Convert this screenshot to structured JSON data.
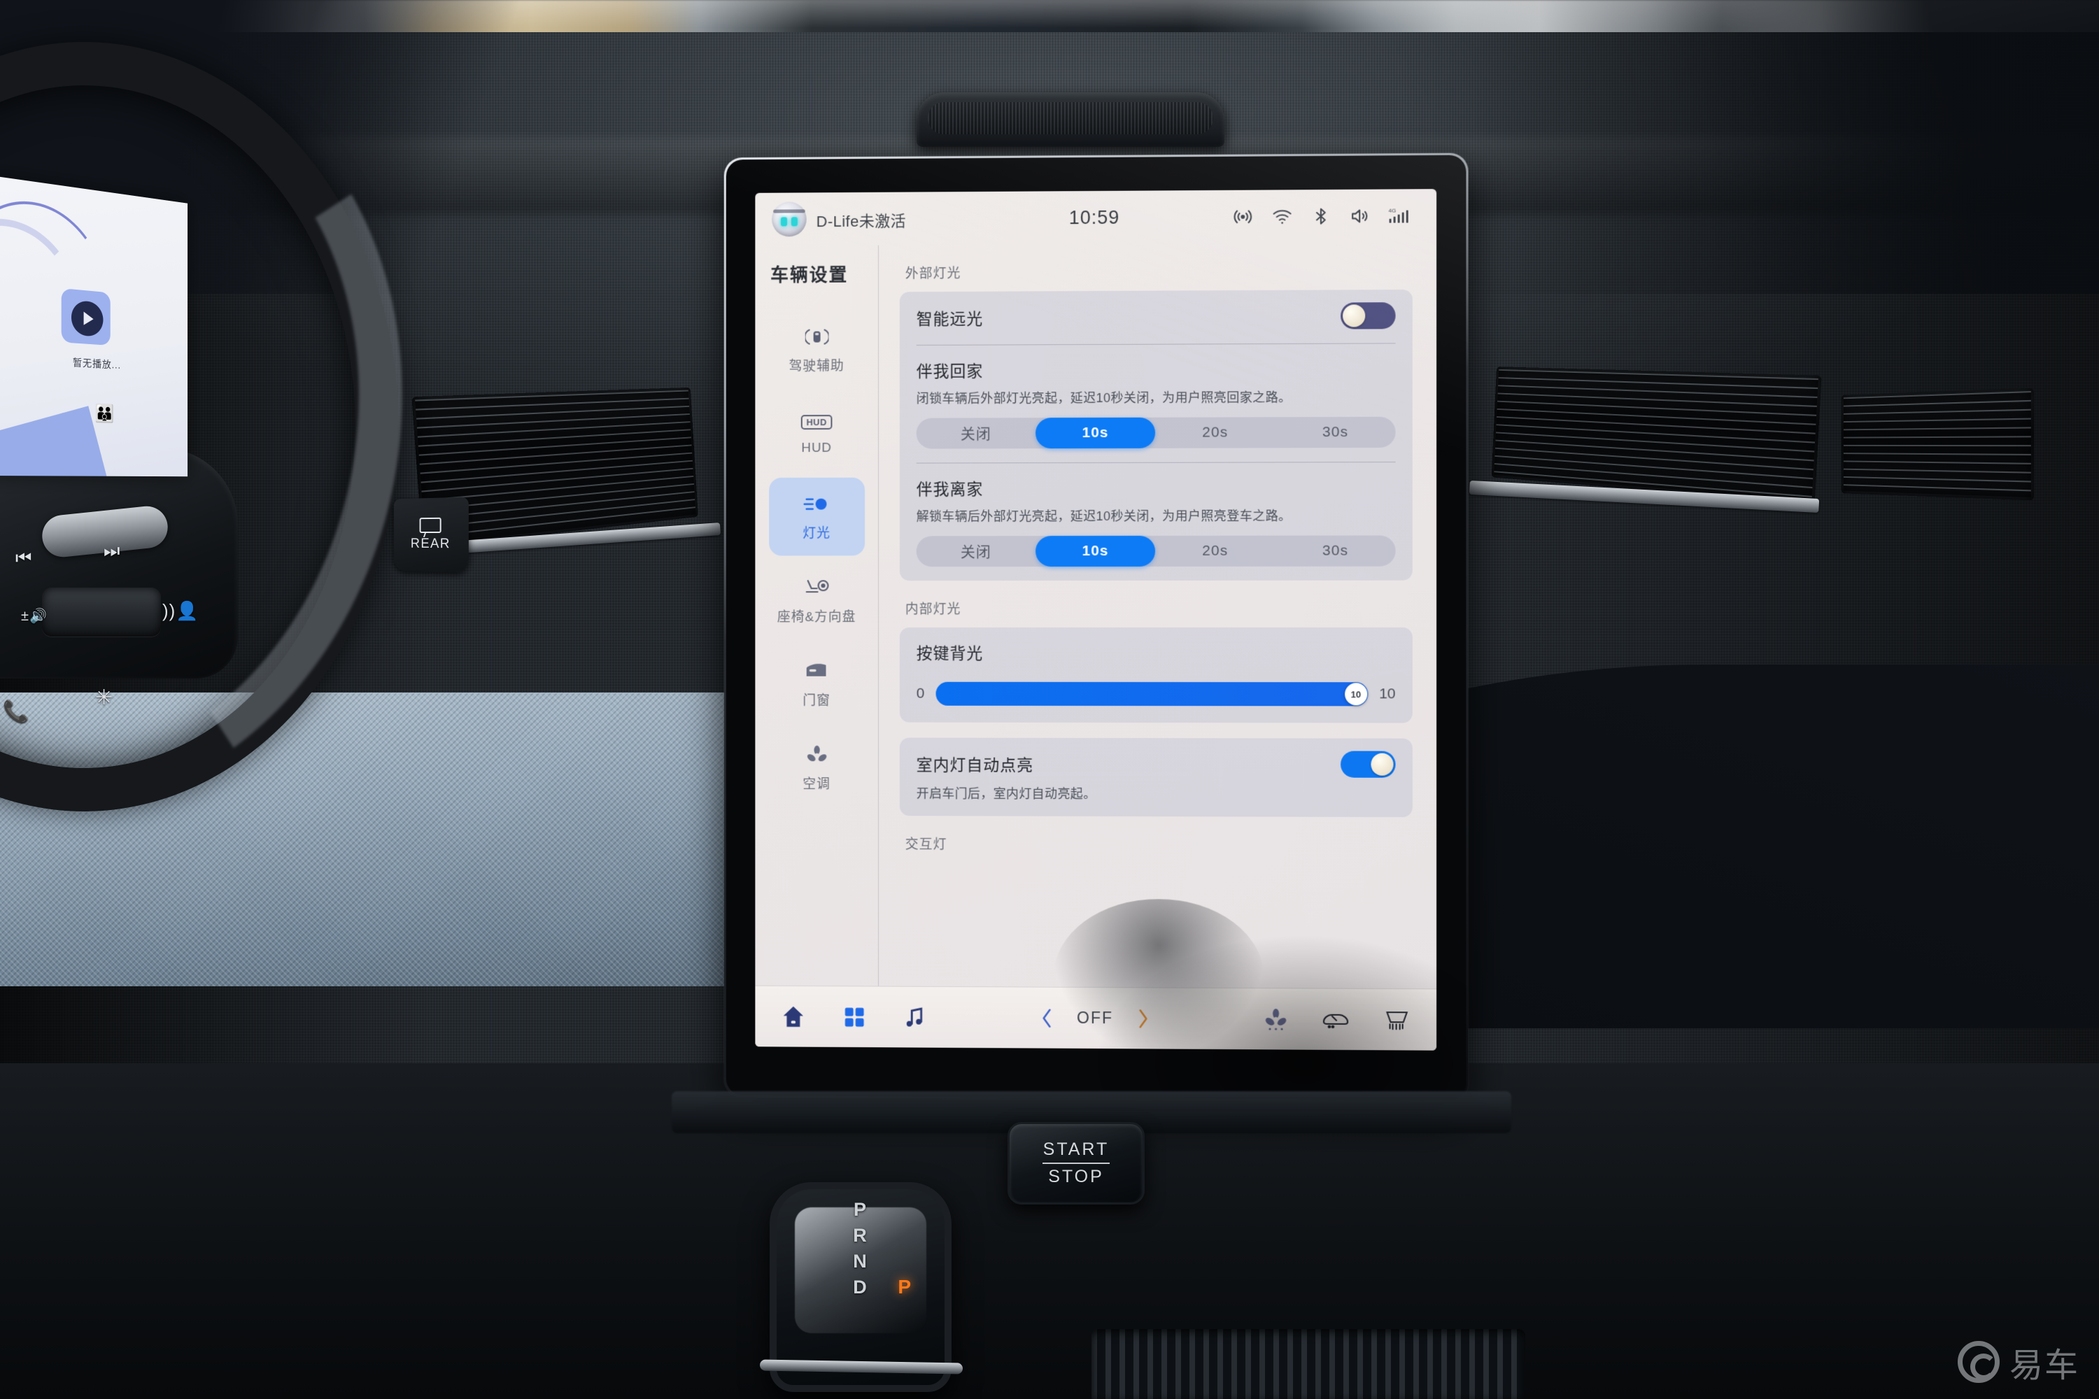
{
  "screen": {
    "statusbar": {
      "assistant_label": "D-Life未激活",
      "clock": "10:59",
      "icons": [
        "hotspot-icon",
        "wifi-icon",
        "bluetooth-icon",
        "volume-icon",
        "signal-4g-icon"
      ],
      "signal_label": "4G"
    },
    "sidebar": {
      "title": "车辆设置",
      "items": [
        {
          "label": "驾驶辅助",
          "icon": "driver-assist-icon",
          "active": false
        },
        {
          "label": "HUD",
          "icon": "hud-icon",
          "active": false
        },
        {
          "label": "灯光",
          "icon": "headlight-icon",
          "active": true
        },
        {
          "label": "座椅&方向盘",
          "icon": "seat-steering-icon",
          "active": false
        },
        {
          "label": "门窗",
          "icon": "door-window-icon",
          "active": false
        },
        {
          "label": "空调",
          "icon": "climate-fan-icon",
          "active": false
        }
      ]
    },
    "content": {
      "exterior_group_label": "外部灯光",
      "interior_group_label": "内部灯光",
      "tail_group_label": "交互灯",
      "smart_high_beam": {
        "title": "智能远光",
        "toggle_state": "off"
      },
      "follow_me_home": {
        "title": "伴我回家",
        "desc": "闭锁车辆后外部灯光亮起，延迟10秒关闭，为用户照亮回家之路。",
        "options": [
          "关闭",
          "10s",
          "20s",
          "30s"
        ],
        "selected": "10s"
      },
      "follow_me_away": {
        "title": "伴我离家",
        "desc": "解锁车辆后外部灯光亮起，延迟10秒关闭，为用户照亮登车之路。",
        "options": [
          "关闭",
          "10s",
          "20s",
          "30s"
        ],
        "selected": "10s"
      },
      "key_backlight": {
        "title": "按键背光",
        "min_label": "0",
        "max_label": "10",
        "value": 10,
        "value_label": "10"
      },
      "interior_auto_light": {
        "title": "室内灯自动点亮",
        "desc": "开启车门后，室内灯自动亮起。",
        "toggle_state": "on"
      }
    },
    "dock": {
      "home": "home-icon",
      "apps": "app-grid-icon",
      "music": "music-note-icon",
      "ac_prev": "chevron-left-icon",
      "ac_state": "OFF",
      "ac_next": "chevron-right-icon",
      "fan": "fan-icon",
      "front_defrost": "front-defrost-icon",
      "rear_defrost": "rear-defrost-icon"
    }
  },
  "cluster": {
    "caption": "暂无播放...",
    "play_icon": "play-icon",
    "seatbelt_icon": "seatbelt-warning-icon"
  },
  "console": {
    "start_stop_top": "START",
    "start_stop_bottom": "STOP",
    "gear_positions": [
      "P",
      "R",
      "N",
      "D"
    ],
    "active_gear": "P",
    "rear_button_label": "REAR"
  },
  "watermark": {
    "text": "易车"
  },
  "colors": {
    "accent_blue": "#0d7bf5",
    "toggle_off_purple": "#4b4b7e",
    "nav_active_bg": "#c2d4f2",
    "nav_active_text": "#2f6ae0",
    "gear_lit_orange": "#ff7a1a"
  }
}
